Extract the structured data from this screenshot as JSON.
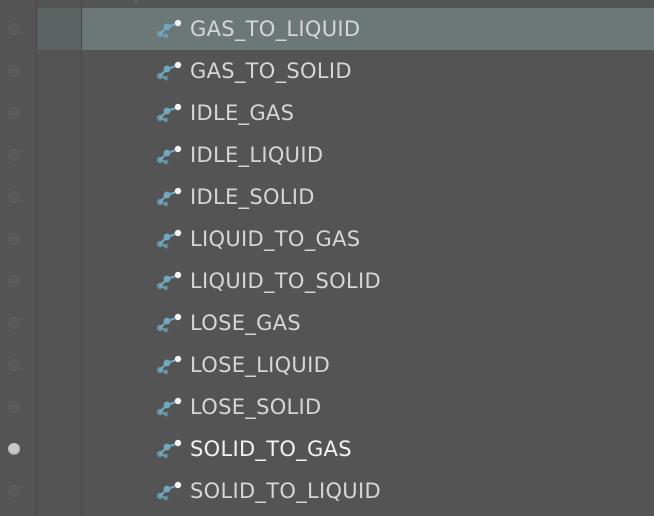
{
  "tree": {
    "selected_index": 0,
    "visibility_on_index": 10,
    "items": [
      {
        "label": "GAS_TO_LIQUID",
        "icon": "state-machine-icon"
      },
      {
        "label": "GAS_TO_SOLID",
        "icon": "state-machine-icon"
      },
      {
        "label": "IDLE_GAS",
        "icon": "state-machine-icon"
      },
      {
        "label": "IDLE_LIQUID",
        "icon": "state-machine-icon"
      },
      {
        "label": "IDLE_SOLID",
        "icon": "state-machine-icon"
      },
      {
        "label": "LIQUID_TO_GAS",
        "icon": "state-machine-icon"
      },
      {
        "label": "LIQUID_TO_SOLID",
        "icon": "state-machine-icon"
      },
      {
        "label": "LOSE_GAS",
        "icon": "state-machine-icon"
      },
      {
        "label": "LOSE_LIQUID",
        "icon": "state-machine-icon"
      },
      {
        "label": "LOSE_SOLID",
        "icon": "state-machine-icon"
      },
      {
        "label": "SOLID_TO_GAS",
        "icon": "state-machine-icon"
      },
      {
        "label": "SOLID_TO_LIQUID",
        "icon": "state-machine-icon"
      }
    ]
  },
  "colors": {
    "background": "#545454",
    "selection": "#6c7777",
    "label_text": "#d6d6d6",
    "icon_accent": "#6fa8bf"
  }
}
